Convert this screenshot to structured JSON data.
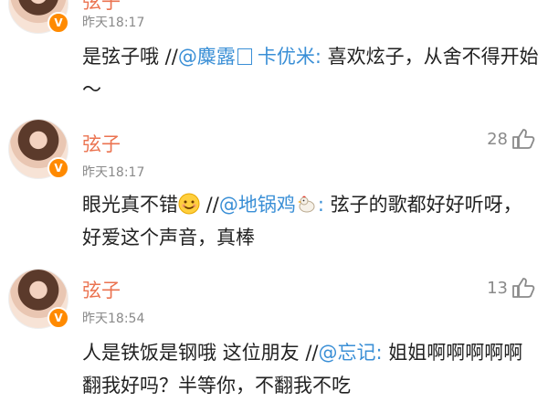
{
  "comments": [
    {
      "name": "弦子",
      "time": "昨天18:17",
      "likes": "",
      "text_before": "是弦子哦 //",
      "mention": "@麋露",
      "mention_suffix": "卡优米:",
      "text_after": " 喜欢炫子，从舍不得开始～",
      "emoji": ""
    },
    {
      "name": "弦子",
      "time": "昨天18:17",
      "likes": "28",
      "text_before": "眼光真不错",
      "emoji": "smiling-face",
      "mid": " //",
      "mention": "@地锅鸡",
      "mention_emoji": "rooster",
      "mention_suffix": ":",
      "text_after": " 弦子的歌都好好听呀，好爱这个声音，真棒"
    },
    {
      "name": "弦子",
      "time": "昨天18:54",
      "likes": "13",
      "text_before": "人是铁饭是钢哦 这位朋友 //",
      "mention": "@忘记:",
      "text_after": " 姐姐啊啊啊啊啊翻我好吗？半等你，不翻我不吃"
    }
  ],
  "badge": "V",
  "colors": {
    "name": "#eb7350",
    "mention": "#3a8fd6",
    "time": "#8a8a8a",
    "badge": "#ff8a00"
  },
  "icons": [
    "thumbs-up-icon",
    "verified-badge-icon",
    "smiling-face-emoji",
    "rooster-emoji",
    "box-glyph-icon"
  ]
}
